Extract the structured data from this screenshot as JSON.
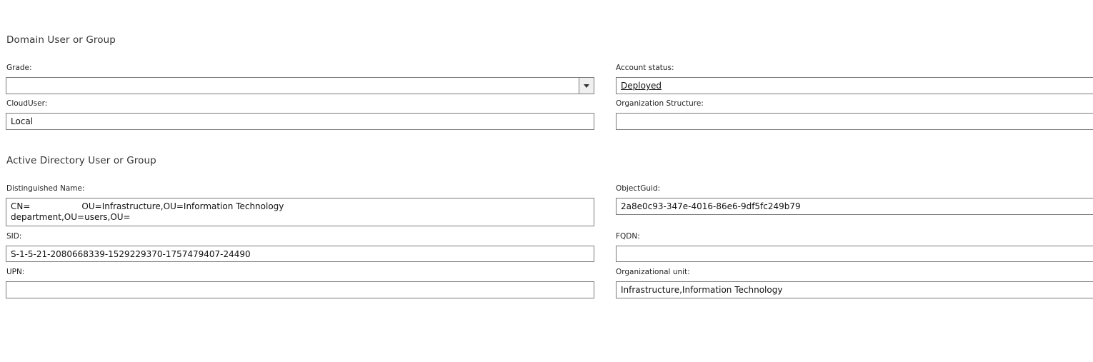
{
  "domain_section": {
    "title": "Domain User or Group",
    "grade": {
      "label": "Grade:",
      "value": ""
    },
    "account_status": {
      "label": "Account status:",
      "value": "Deployed"
    },
    "cloud_user": {
      "label": "CloudUser:",
      "value": "Local"
    },
    "org_structure": {
      "label": "Organization Structure:",
      "value": ""
    }
  },
  "ad_section": {
    "title": "Active Directory User or Group",
    "distinguished_name": {
      "label": "Distinguished Name:",
      "value": "CN=      OU=Infrastructure,OU=Information Technology department,OU=users,OU="
    },
    "object_guid": {
      "label": "ObjectGuid:",
      "value": "2a8e0c93-347e-4016-86e6-9df5fc249b79"
    },
    "sid": {
      "label": "SID:",
      "value": "S-1-5-21-2080668339-1529229370-1757479407-24490"
    },
    "fqdn": {
      "label": "FQDN:",
      "value": ""
    },
    "upn": {
      "label": "UPN:",
      "value": ""
    },
    "org_unit": {
      "label": "Organizational unit:",
      "value": "Infrastructure,Information Technology"
    }
  }
}
